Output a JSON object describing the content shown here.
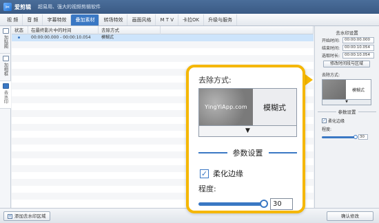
{
  "titlebar": {
    "app_name": "爱剪辑",
    "slogan": "超易用、强大的视频剪辑软件",
    "logo_icon": "scissors-icon"
  },
  "menu_tabs": [
    {
      "label": "视 频"
    },
    {
      "label": "音 频"
    },
    {
      "label": "字幕特效"
    },
    {
      "label": "叠加素材",
      "active": true
    },
    {
      "label": "转场特效"
    },
    {
      "label": "画面风格"
    },
    {
      "label": "M T V"
    },
    {
      "label": "卡拉OK"
    },
    {
      "label": "升级与服务"
    }
  ],
  "left_nav": [
    {
      "label": "加贴图",
      "icon": "image-icon"
    },
    {
      "label": "加相框",
      "icon": "frame-icon"
    },
    {
      "label": "去水印",
      "icon": "watermark-icon",
      "active": true
    }
  ],
  "table": {
    "columns": [
      "状态",
      "在最终影片中的时间",
      "去除方式"
    ],
    "rows": [
      {
        "time": "00:00:00.000 - 00:00:10.054",
        "method": "模糊式",
        "selected": true
      }
    ]
  },
  "right_panel": {
    "section_title": "去水印设置",
    "start_label": "开始时间:",
    "start_value": "00:00:00.000",
    "end_label": "结束时间:",
    "end_value": "00:00:10.054",
    "duration_label": "选取时长:",
    "duration_value": "00:00:10.054",
    "modify_button": "修改时间段与区域",
    "method_label": "去除方式:",
    "method_value": "模糊式",
    "params_title": "参数设置",
    "soften_label": "柔化边缘",
    "degree_label": "程度:",
    "degree_value": "30"
  },
  "callout": {
    "method_label": "去除方式:",
    "thumb_text": "YingYiApp.com",
    "method_value": "模糊式",
    "dropdown_arrow": "▼",
    "params_title": "参数设置",
    "soften_label": "柔化边缘",
    "degree_label": "程度:",
    "degree_value": "30",
    "highlight_color": "#f5b700"
  },
  "bottombar": {
    "add_button": "添加去水印区域",
    "confirm_button": "确认修改"
  }
}
